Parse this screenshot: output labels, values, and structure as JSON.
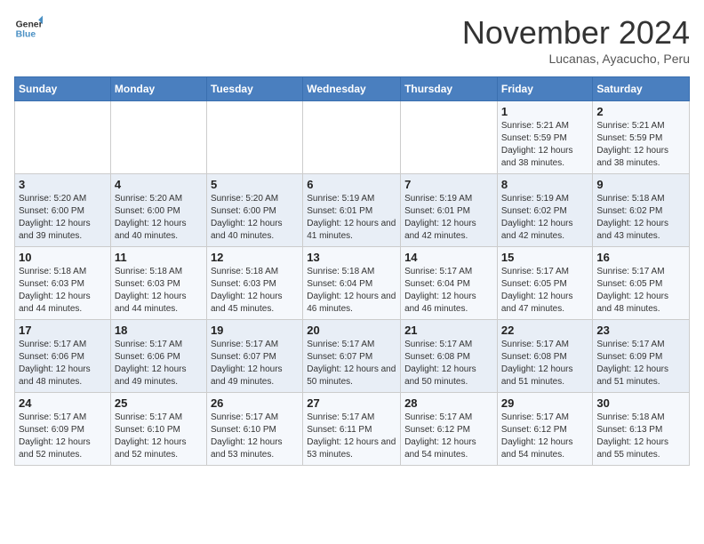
{
  "logo": {
    "general": "General",
    "blue": "Blue"
  },
  "title": "November 2024",
  "location": "Lucanas, Ayacucho, Peru",
  "days_of_week": [
    "Sunday",
    "Monday",
    "Tuesday",
    "Wednesday",
    "Thursday",
    "Friday",
    "Saturday"
  ],
  "weeks": [
    [
      {
        "day": "",
        "info": ""
      },
      {
        "day": "",
        "info": ""
      },
      {
        "day": "",
        "info": ""
      },
      {
        "day": "",
        "info": ""
      },
      {
        "day": "",
        "info": ""
      },
      {
        "day": "1",
        "info": "Sunrise: 5:21 AM\nSunset: 5:59 PM\nDaylight: 12 hours and 38 minutes."
      },
      {
        "day": "2",
        "info": "Sunrise: 5:21 AM\nSunset: 5:59 PM\nDaylight: 12 hours and 38 minutes."
      }
    ],
    [
      {
        "day": "3",
        "info": "Sunrise: 5:20 AM\nSunset: 6:00 PM\nDaylight: 12 hours and 39 minutes."
      },
      {
        "day": "4",
        "info": "Sunrise: 5:20 AM\nSunset: 6:00 PM\nDaylight: 12 hours and 40 minutes."
      },
      {
        "day": "5",
        "info": "Sunrise: 5:20 AM\nSunset: 6:00 PM\nDaylight: 12 hours and 40 minutes."
      },
      {
        "day": "6",
        "info": "Sunrise: 5:19 AM\nSunset: 6:01 PM\nDaylight: 12 hours and 41 minutes."
      },
      {
        "day": "7",
        "info": "Sunrise: 5:19 AM\nSunset: 6:01 PM\nDaylight: 12 hours and 42 minutes."
      },
      {
        "day": "8",
        "info": "Sunrise: 5:19 AM\nSunset: 6:02 PM\nDaylight: 12 hours and 42 minutes."
      },
      {
        "day": "9",
        "info": "Sunrise: 5:18 AM\nSunset: 6:02 PM\nDaylight: 12 hours and 43 minutes."
      }
    ],
    [
      {
        "day": "10",
        "info": "Sunrise: 5:18 AM\nSunset: 6:03 PM\nDaylight: 12 hours and 44 minutes."
      },
      {
        "day": "11",
        "info": "Sunrise: 5:18 AM\nSunset: 6:03 PM\nDaylight: 12 hours and 44 minutes."
      },
      {
        "day": "12",
        "info": "Sunrise: 5:18 AM\nSunset: 6:03 PM\nDaylight: 12 hours and 45 minutes."
      },
      {
        "day": "13",
        "info": "Sunrise: 5:18 AM\nSunset: 6:04 PM\nDaylight: 12 hours and 46 minutes."
      },
      {
        "day": "14",
        "info": "Sunrise: 5:17 AM\nSunset: 6:04 PM\nDaylight: 12 hours and 46 minutes."
      },
      {
        "day": "15",
        "info": "Sunrise: 5:17 AM\nSunset: 6:05 PM\nDaylight: 12 hours and 47 minutes."
      },
      {
        "day": "16",
        "info": "Sunrise: 5:17 AM\nSunset: 6:05 PM\nDaylight: 12 hours and 48 minutes."
      }
    ],
    [
      {
        "day": "17",
        "info": "Sunrise: 5:17 AM\nSunset: 6:06 PM\nDaylight: 12 hours and 48 minutes."
      },
      {
        "day": "18",
        "info": "Sunrise: 5:17 AM\nSunset: 6:06 PM\nDaylight: 12 hours and 49 minutes."
      },
      {
        "day": "19",
        "info": "Sunrise: 5:17 AM\nSunset: 6:07 PM\nDaylight: 12 hours and 49 minutes."
      },
      {
        "day": "20",
        "info": "Sunrise: 5:17 AM\nSunset: 6:07 PM\nDaylight: 12 hours and 50 minutes."
      },
      {
        "day": "21",
        "info": "Sunrise: 5:17 AM\nSunset: 6:08 PM\nDaylight: 12 hours and 50 minutes."
      },
      {
        "day": "22",
        "info": "Sunrise: 5:17 AM\nSunset: 6:08 PM\nDaylight: 12 hours and 51 minutes."
      },
      {
        "day": "23",
        "info": "Sunrise: 5:17 AM\nSunset: 6:09 PM\nDaylight: 12 hours and 51 minutes."
      }
    ],
    [
      {
        "day": "24",
        "info": "Sunrise: 5:17 AM\nSunset: 6:09 PM\nDaylight: 12 hours and 52 minutes."
      },
      {
        "day": "25",
        "info": "Sunrise: 5:17 AM\nSunset: 6:10 PM\nDaylight: 12 hours and 52 minutes."
      },
      {
        "day": "26",
        "info": "Sunrise: 5:17 AM\nSunset: 6:10 PM\nDaylight: 12 hours and 53 minutes."
      },
      {
        "day": "27",
        "info": "Sunrise: 5:17 AM\nSunset: 6:11 PM\nDaylight: 12 hours and 53 minutes."
      },
      {
        "day": "28",
        "info": "Sunrise: 5:17 AM\nSunset: 6:12 PM\nDaylight: 12 hours and 54 minutes."
      },
      {
        "day": "29",
        "info": "Sunrise: 5:17 AM\nSunset: 6:12 PM\nDaylight: 12 hours and 54 minutes."
      },
      {
        "day": "30",
        "info": "Sunrise: 5:18 AM\nSunset: 6:13 PM\nDaylight: 12 hours and 55 minutes."
      }
    ]
  ]
}
